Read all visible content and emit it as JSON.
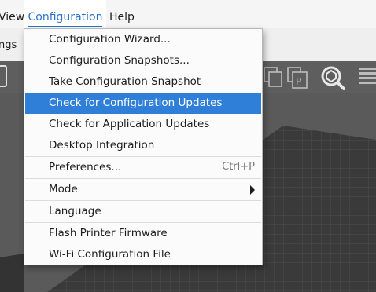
{
  "menubar": {
    "items": [
      "View",
      "Configuration",
      "Help"
    ]
  },
  "tabstrip": {
    "partial_label": "ngs"
  },
  "toolbar": {
    "icons": [
      "print-plate-icon",
      "copy-icon",
      "paste-icon",
      "search-icon",
      "layers-icon"
    ]
  },
  "dropdown": {
    "items": [
      {
        "label": "Configuration Wizard..."
      },
      {
        "label": "Configuration Snapshots..."
      },
      {
        "label": "Take Configuration Snapshot"
      },
      {
        "label": "Check for Configuration Updates"
      },
      {
        "label": "Check for Application Updates"
      },
      {
        "label": "Desktop Integration"
      },
      {
        "label": "Preferences...",
        "shortcut": "Ctrl+P"
      },
      {
        "label": "Mode"
      },
      {
        "label": "Language"
      },
      {
        "label": "Flash Printer Firmware"
      },
      {
        "label": "Wi-Fi Configuration File"
      }
    ],
    "highlighted_index": 3,
    "highlight_color": "#2f7fd8"
  },
  "colors": {
    "menubar_bg": "#f5f5f5",
    "active_menu_text": "#2a73c9",
    "toolbar_bg": "#5e5e5e",
    "bed_color": "#3a3a3a"
  }
}
